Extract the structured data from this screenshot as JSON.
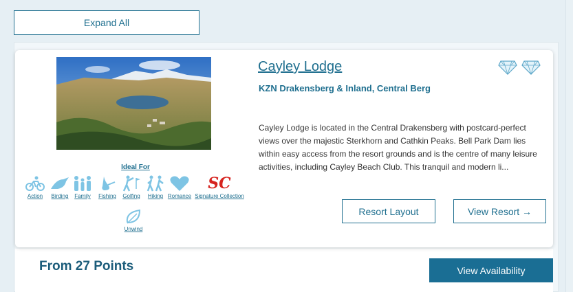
{
  "toolbar": {
    "expand_label": "Expand All"
  },
  "resort": {
    "name": "Cayley Lodge",
    "region": "KZN Drakensberg & Inland, Central Berg",
    "description": "Cayley Lodge is located in the Central Drakensberg with postcard-perfect views over the majestic Sterkhorn and Cathkin Peaks. Bell Park Dam lies within easy access from the resort grounds and is the centre of many leisure activities, including Cayley Beach Club. This tranquil and modern li...",
    "ideal_for_title": "Ideal For",
    "activities": [
      {
        "label": "Action",
        "icon": "cyclist-icon"
      },
      {
        "label": "Birding",
        "icon": "bird-icon"
      },
      {
        "label": "Family",
        "icon": "family-icon"
      },
      {
        "label": "Fishing",
        "icon": "fish-icon"
      },
      {
        "label": "Golfing",
        "icon": "golfer-icon"
      },
      {
        "label": "Hiking",
        "icon": "hikers-icon"
      },
      {
        "label": "Romance",
        "icon": "heart-icon"
      },
      {
        "label": "Signature Collection",
        "icon": "signature-collection-logo",
        "logo_text": "SC"
      },
      {
        "label": "Unwind",
        "icon": "leaf-icon"
      }
    ],
    "rating_icons": [
      "diamond-rating-icon",
      "diamond-rating-icon"
    ],
    "resort_layout_label": "Resort Layout",
    "view_resort_label": "View Resort →"
  },
  "pricing": {
    "from_label": "From 27 Points",
    "availability_label": "View Availability"
  },
  "colors": {
    "brand": "#1f6f8f",
    "icon_light": "#7ec4e4",
    "signature_red": "#d6231e",
    "primary_button": "#1a6e94"
  }
}
